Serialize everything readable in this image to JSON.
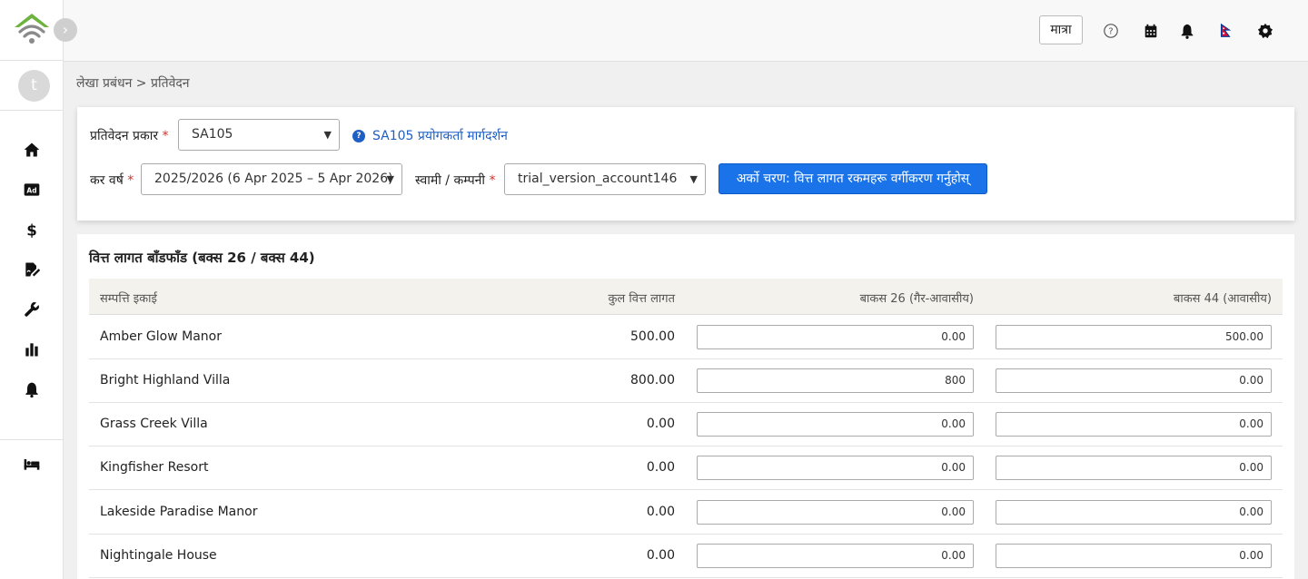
{
  "topbar": {
    "matra_label": "मात्रा",
    "icons": [
      "help-icon",
      "calendar-icon",
      "bell-icon",
      "flag-icon",
      "gear-icon"
    ]
  },
  "sidebar": {
    "avatar_initial": "t",
    "collapse_glyph": "›",
    "items": [
      "home-icon",
      "ad-icon",
      "dollar-icon",
      "signature-icon",
      "wrench-icon",
      "bar-chart-icon",
      "bell-icon",
      "bed-icon"
    ]
  },
  "breadcrumb": {
    "text": "लेखा प्रबंधन > प्रतिवेदन"
  },
  "filters": {
    "report_type_label": "प्रतिवेदन प्रकार",
    "report_type_value": "SA105",
    "guide_link": "SA105 प्रयोगकर्ता मार्गदर्शन",
    "tax_year_label": "कर वर्ष",
    "tax_year_value": "2025/2026 (6 Apr 2025 – 5 Apr 2026)",
    "owner_label": "स्वामी / कम्पनी",
    "owner_value": "trial_version_account146",
    "next_button": "अर्को चरण: वित्त लागत रकमहरू वर्गीकरण गर्नुहोस्",
    "required_mark": "*"
  },
  "table": {
    "title": "वित्त लागत बाँडफाँड (बक्स 26 / बक्स 44)",
    "headers": {
      "property": "सम्पत्ति इकाई",
      "total": "कुल वित्त लागत",
      "box26": "बाकस 26 (गैर-आवासीय)",
      "box44": "बाकस 44 (आवासीय)"
    },
    "rows": [
      {
        "name": "Amber Glow Manor",
        "total": "500.00",
        "box26": "0.00",
        "box44": "500.00"
      },
      {
        "name": "Bright Highland Villa",
        "total": "800.00",
        "box26": "800",
        "box44": "0.00"
      },
      {
        "name": "Grass Creek Villa",
        "total": "0.00",
        "box26": "0.00",
        "box44": "0.00"
      },
      {
        "name": "Kingfisher Resort",
        "total": "0.00",
        "box26": "0.00",
        "box44": "0.00"
      },
      {
        "name": "Lakeside Paradise Manor",
        "total": "0.00",
        "box26": "0.00",
        "box44": "0.00"
      },
      {
        "name": "Nightingale House",
        "total": "0.00",
        "box26": "0.00",
        "box44": "0.00"
      }
    ]
  },
  "colors": {
    "primary": "#1a73e8",
    "link": "#1d5fc4",
    "required": "#d9302c",
    "logo_green": "#6db33f"
  }
}
